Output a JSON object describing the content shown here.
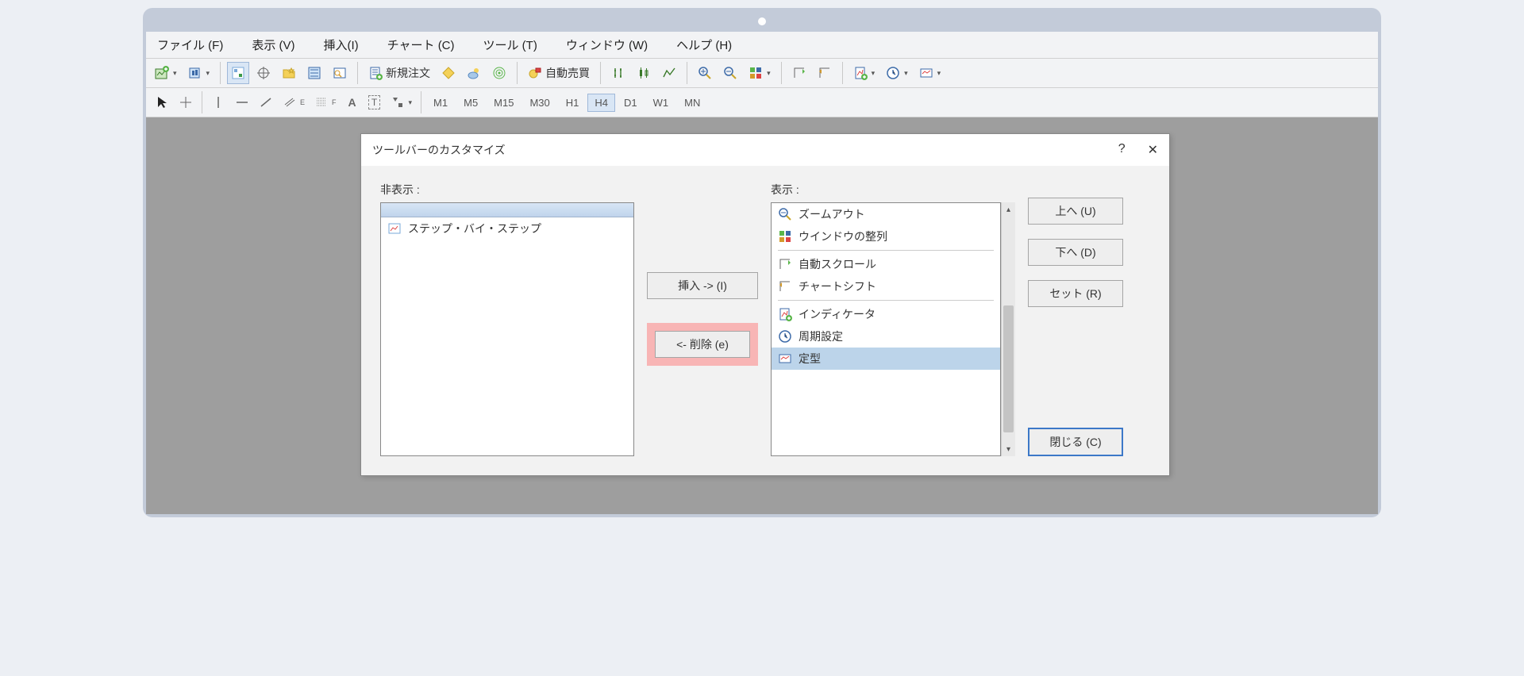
{
  "menu": {
    "file": "ファイル (F)",
    "view": "表示 (V)",
    "insert": "挿入(I)",
    "chart": "チャート (C)",
    "tool": "ツール (T)",
    "window": "ウィンドウ (W)",
    "help": "ヘルプ (H)"
  },
  "toolbar": {
    "new_order": "新規注文",
    "auto_trade": "自動売買"
  },
  "periods": {
    "m1": "M1",
    "m5": "M5",
    "m15": "M15",
    "m30": "M30",
    "h1": "H1",
    "h4": "H4",
    "d1": "D1",
    "w1": "W1",
    "mn": "MN",
    "a": "A",
    "t": "T",
    "e": "E",
    "f": "F"
  },
  "dialog": {
    "title": "ツールバーのカスタマイズ",
    "help": "?",
    "close_x": "✕",
    "hide_label": "非表示 :",
    "show_label": "表示 :",
    "hidden_items": {
      "step": "ステップ・バイ・ステップ"
    },
    "shown_items": {
      "zoom_out": "ズームアウト",
      "arrange": "ウインドウの整列",
      "auto_scroll": "自動スクロール",
      "chart_shift": "チャートシフト",
      "indicator": "インディケータ",
      "period_set": "周期設定",
      "template": "定型"
    },
    "btn_insert": "挿入 -> (I)",
    "btn_remove": "<- 削除 (e)",
    "btn_up": "上へ (U)",
    "btn_down": "下へ (D)",
    "btn_set": "セット (R)",
    "btn_close": "閉じる (C)"
  }
}
